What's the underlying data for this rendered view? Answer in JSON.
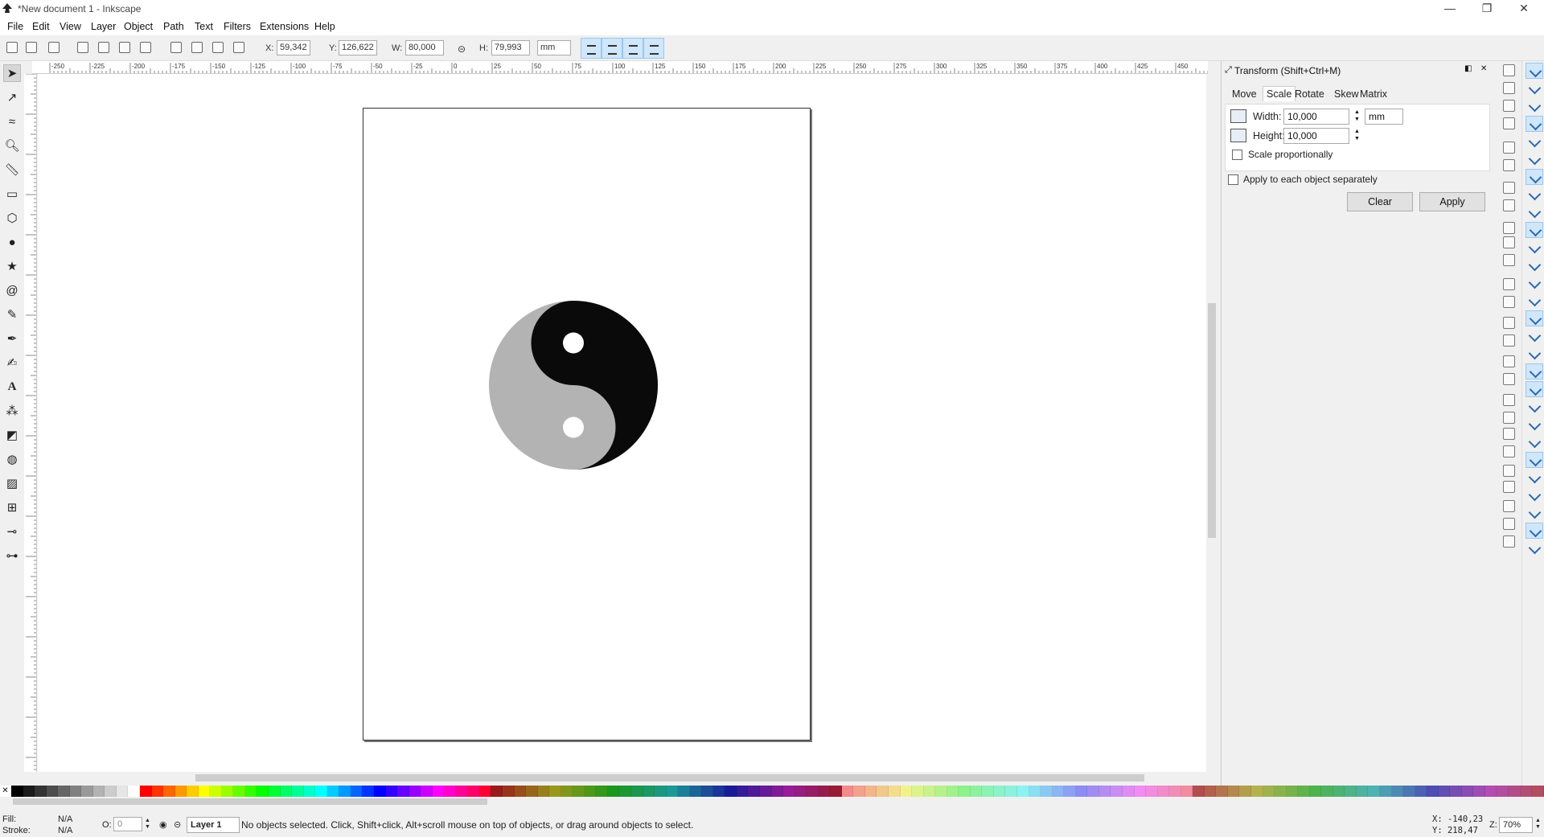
{
  "window": {
    "title": "*New document 1 - Inkscape",
    "controls": [
      "—",
      "❐",
      "✕"
    ]
  },
  "menu": [
    "File",
    "Edit",
    "View",
    "Layer",
    "Object",
    "Path",
    "Text",
    "Filters",
    "Extensions",
    "Help"
  ],
  "toolbar": {
    "x_label": "X:",
    "x_value": "59,342",
    "y_label": "Y:",
    "y_value": "126,622",
    "w_label": "W:",
    "w_value": "80,000",
    "h_label": "H:",
    "h_value": "79,993",
    "unit": "mm"
  },
  "tools": [
    "selector-tool",
    "node-tool",
    "tweak-tool",
    "zoom-tool",
    "measure-tool",
    "rect-tool",
    "3dbox-tool",
    "ellipse-tool",
    "star-tool",
    "spiral-tool",
    "pencil-tool",
    "pen-tool",
    "calligraphy-tool",
    "text-tool",
    "spray-tool",
    "eraser-tool",
    "paint-bucket-tool",
    "gradient-tool",
    "mesh-tool",
    "dropper-tool",
    "connector-tool"
  ],
  "ruler_top_labels": [
    "-250",
    "-225",
    "-200",
    "-175",
    "-150",
    "-125",
    "-100",
    "-75",
    "-50",
    "-25",
    "0",
    "25",
    "50",
    "75",
    "100",
    "125",
    "150",
    "175",
    "200",
    "225",
    "250",
    "275",
    "300",
    "325",
    "350",
    "375",
    "400",
    "425",
    "450"
  ],
  "dock": {
    "title": "Transform (Shift+Ctrl+M)",
    "tabs": [
      "Move",
      "Scale",
      "Rotate",
      "Skew",
      "Matrix"
    ],
    "active_tab": "Scale",
    "width_label": "Width:",
    "width_value": "10,000",
    "height_label": "Height:",
    "height_value": "10,000",
    "unit": "mm",
    "scale_prop_label": "Scale proportionally",
    "apply_each_label": "Apply to each object separately",
    "clear_label": "Clear",
    "apply_label": "Apply"
  },
  "status": {
    "fill_label": "Fill:",
    "fill_value": "N/A",
    "stroke_label": "Stroke:",
    "stroke_value": "N/A",
    "opacity_label": "O:",
    "opacity_value": "0",
    "layer": "Layer 1",
    "message": "No objects selected. Click, Shift+click, Alt+scroll mouse on top of objects, or drag around objects to select.",
    "cursor_x": "X: -140,23",
    "cursor_y": "Y:  218,47",
    "zoom_label": "Z:",
    "zoom": "70%"
  },
  "colors": {
    "accent": "#cfe6fb",
    "yin": "#0a0a0a",
    "yang": "#b3b3b3"
  }
}
